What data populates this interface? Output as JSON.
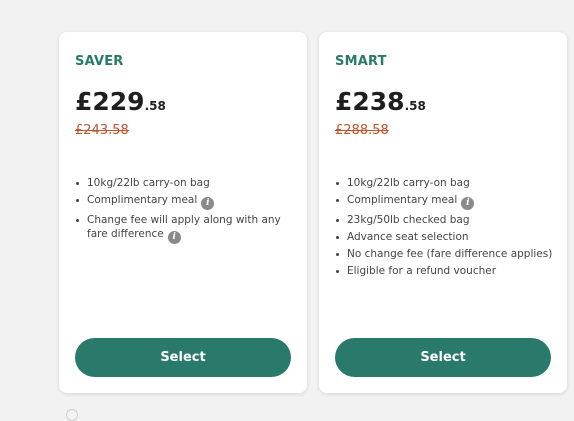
{
  "fares": [
    {
      "name": "SAVER",
      "price_major": "£229",
      "price_minor": ".58",
      "old_price": "£243.58",
      "features": [
        {
          "text": "10kg/22lb carry-on bag",
          "info": false
        },
        {
          "text": "Complimentary meal",
          "info": true
        },
        {
          "text": "Change fee will apply along with any fare difference",
          "info": true
        }
      ],
      "button_label": "Select"
    },
    {
      "name": "SMART",
      "price_major": "£238",
      "price_minor": ".58",
      "old_price": "£288.58",
      "features": [
        {
          "text": "10kg/22lb carry-on bag",
          "info": false
        },
        {
          "text": "Complimentary meal",
          "info": true
        },
        {
          "text": "23kg/50lb checked bag",
          "info": false
        },
        {
          "text": "Advance seat selection",
          "info": false
        },
        {
          "text": "No change fee (fare difference applies)",
          "info": false
        },
        {
          "text": "Eligible for a refund voucher",
          "info": false
        }
      ],
      "button_label": "Select"
    }
  ],
  "icons": {
    "info": "info-icon",
    "info_glyph": "i"
  },
  "colors": {
    "accent": "#2a7a6c",
    "old_price": "#c0542a",
    "background": "#f2f2f2"
  }
}
